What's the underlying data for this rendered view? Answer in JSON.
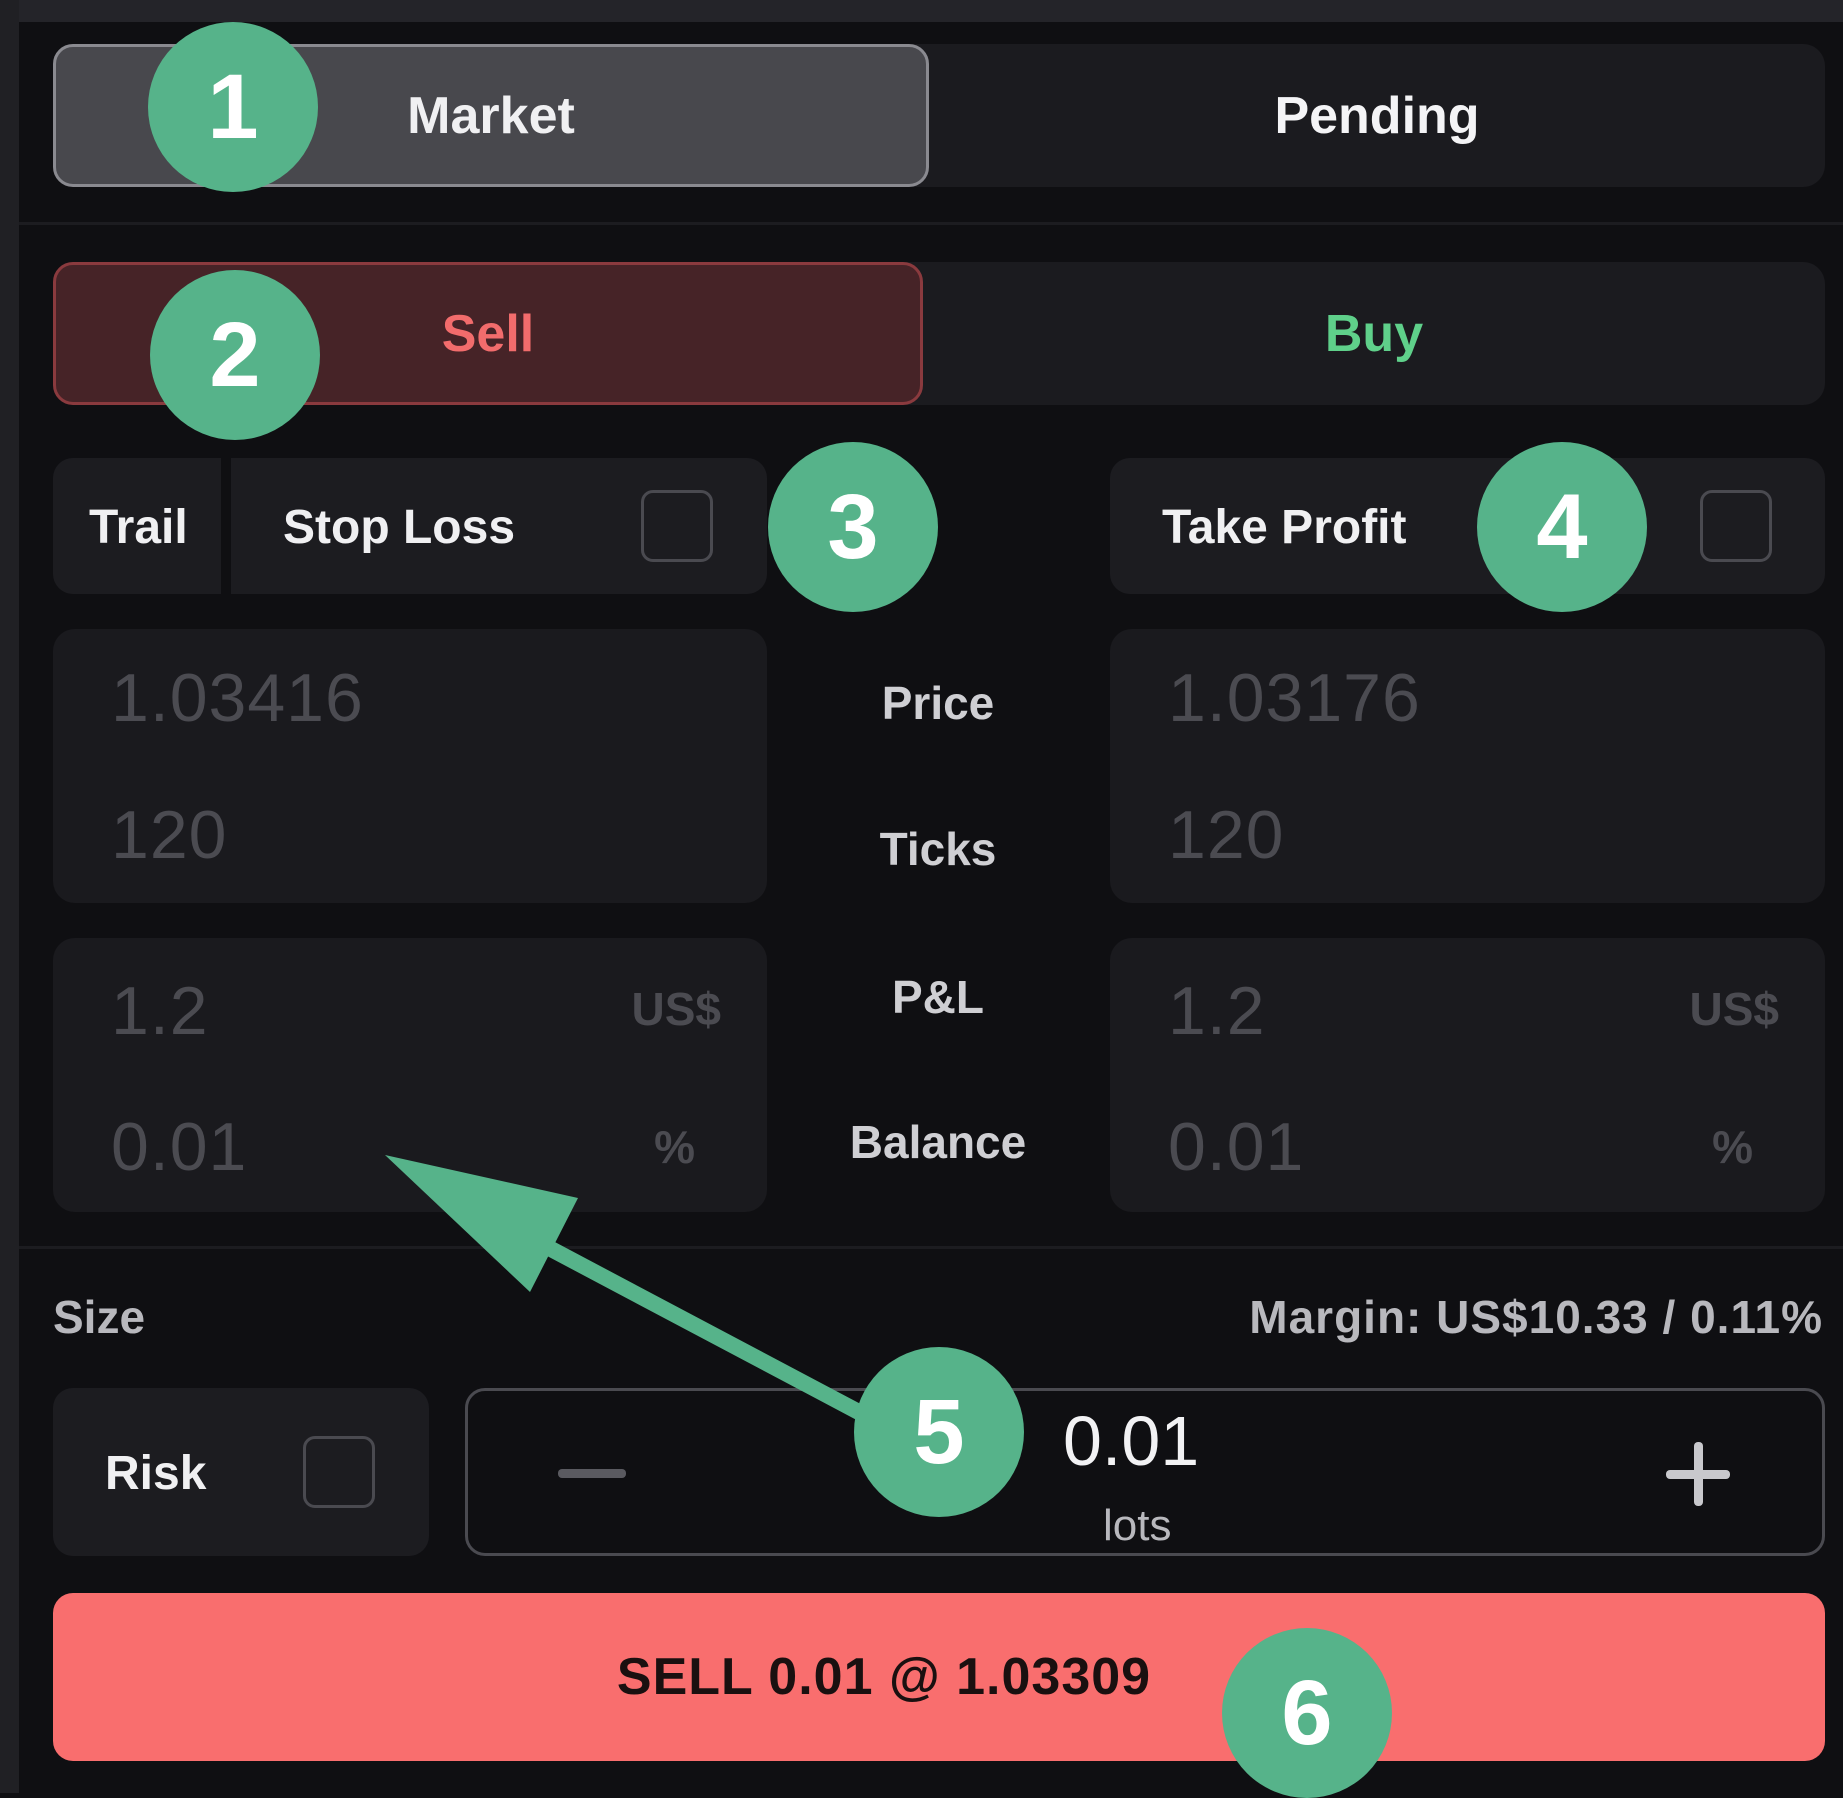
{
  "order_type_tabs": {
    "market": "Market",
    "pending": "Pending"
  },
  "side_tabs": {
    "sell": "Sell",
    "buy": "Buy"
  },
  "stop_loss": {
    "trail_label": "Trail",
    "label": "Stop Loss",
    "price": "1.03416",
    "ticks": "120",
    "pnl": "1.2",
    "pnl_unit": "US$",
    "balance": "0.01",
    "balance_unit": "%"
  },
  "take_profit": {
    "label": "Take Profit",
    "price": "1.03176",
    "ticks": "120",
    "pnl": "1.2",
    "pnl_unit": "US$",
    "balance": "0.01",
    "balance_unit": "%"
  },
  "row_labels": {
    "price": "Price",
    "ticks": "Ticks",
    "pnl": "P&L",
    "balance": "Balance"
  },
  "size": {
    "label": "Size",
    "margin": "Margin: US$10.33 / 0.11%",
    "risk_label": "Risk",
    "value": "0.01",
    "unit": "lots"
  },
  "submit_button": "SELL 0.01 @ 1.03309",
  "annotations": [
    "1",
    "2",
    "3",
    "4",
    "5",
    "6"
  ],
  "colors": {
    "sell": "#f26c6c",
    "buy": "#5fd08a",
    "sell_button": "#f96e6e",
    "badge": "#56b38a"
  }
}
